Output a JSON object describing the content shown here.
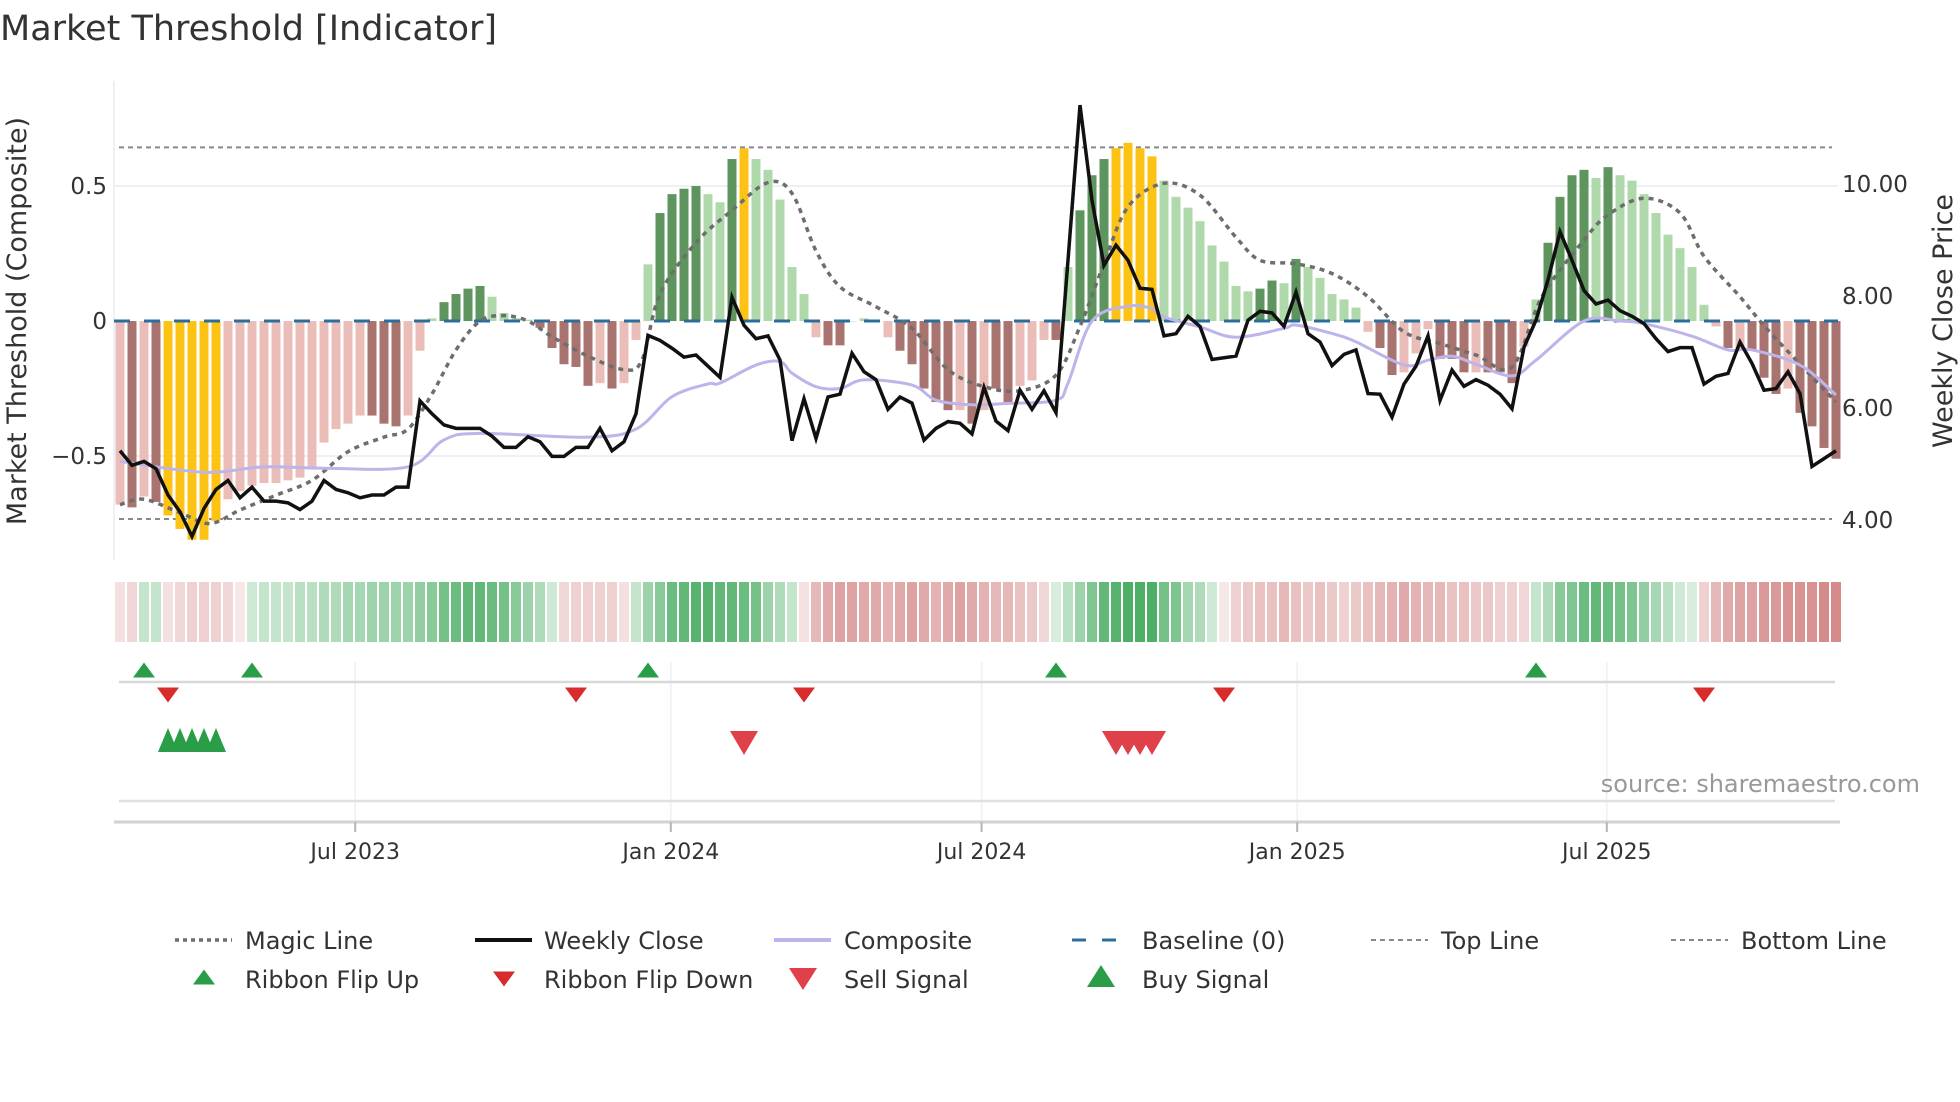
{
  "title": "Market Threshold [Indicator]",
  "source": "source: sharemaestro.com",
  "chart_data": {
    "type": "bar",
    "title": "Market Threshold [Indicator]",
    "left_axis": {
      "label": "Market Threshold (Composite)",
      "range": [
        -0.885,
        0.889
      ],
      "ticks": [
        {
          "value": 0.5,
          "label": "0.5"
        },
        {
          "value": 0,
          "label": "0"
        },
        {
          "value": -0.5,
          "label": "−0.5"
        }
      ]
    },
    "right_axis": {
      "label": "Weekly Close Price",
      "range": [
        3.29,
        11.84
      ],
      "ticks": [
        {
          "value": 10,
          "label": "10.00"
        },
        {
          "value": 8,
          "label": "8.00"
        },
        {
          "value": 6,
          "label": "6.00"
        },
        {
          "value": 4,
          "label": "4.00"
        }
      ]
    },
    "x_axis": {
      "unit": "week index",
      "range": [
        -0.5,
        143.5
      ],
      "ticks": [
        {
          "week": 19.6,
          "label": "Jul 2023"
        },
        {
          "week": 45.9,
          "label": "Jan 2024"
        },
        {
          "week": 71.8,
          "label": "Jul 2024"
        },
        {
          "week": 98.1,
          "label": "Jan 2025"
        },
        {
          "week": 123.9,
          "label": "Jul 2025"
        }
      ]
    },
    "grid": true,
    "legend_placement": "bottom",
    "top_line": 0.643,
    "bottom_line": -0.733,
    "baseline": 0,
    "composite_bars": {
      "values": [
        -0.68,
        -0.69,
        -0.65,
        -0.67,
        -0.72,
        -0.77,
        -0.81,
        -0.81,
        -0.74,
        -0.66,
        -0.63,
        -0.61,
        -0.6,
        -0.6,
        -0.59,
        -0.58,
        -0.55,
        -0.45,
        -0.4,
        -0.38,
        -0.35,
        -0.35,
        -0.38,
        -0.39,
        -0.35,
        -0.11,
        0.01,
        0.07,
        0.1,
        0.12,
        0.13,
        0.09,
        0.03,
        0.01,
        0.005,
        -0.025,
        -0.1,
        -0.16,
        -0.17,
        -0.24,
        -0.23,
        -0.25,
        -0.23,
        -0.07,
        0.21,
        0.4,
        0.47,
        0.49,
        0.5,
        0.47,
        0.44,
        0.6,
        0.64,
        0.6,
        0.56,
        0.45,
        0.2,
        0.1,
        -0.06,
        -0.09,
        -0.09,
        0,
        0.01,
        0,
        -0.06,
        -0.11,
        -0.16,
        -0.25,
        -0.3,
        -0.33,
        -0.33,
        -0.38,
        -0.33,
        -0.25,
        -0.3,
        -0.24,
        -0.22,
        -0.07,
        -0.07,
        0.2,
        0.41,
        0.54,
        0.6,
        0.64,
        0.66,
        0.64,
        0.61,
        0.52,
        0.46,
        0.42,
        0.37,
        0.28,
        0.22,
        0.13,
        0.11,
        0.12,
        0.15,
        0.14,
        0.23,
        0.2,
        0.16,
        0.1,
        0.08,
        0.05,
        -0.04,
        -0.1,
        -0.2,
        -0.19,
        -0.12,
        -0.03,
        -0.14,
        -0.14,
        -0.19,
        -0.19,
        -0.19,
        -0.19,
        -0.23,
        -0.095,
        0.08,
        0.29,
        0.46,
        0.54,
        0.56,
        0.53,
        0.57,
        0.54,
        0.52,
        0.47,
        0.4,
        0.32,
        0.27,
        0.2,
        0.06,
        -0.02,
        -0.1,
        -0.1,
        -0.11,
        -0.21,
        -0.27,
        -0.25,
        -0.34,
        -0.39,
        -0.47,
        -0.51
      ],
      "kind_runs": [
        [
          "lr",
          1
        ],
        [
          "dr",
          1
        ],
        [
          "lr",
          1
        ],
        [
          "dr",
          1
        ],
        [
          "y",
          5
        ],
        [
          "lr",
          12
        ],
        [
          "dr",
          3
        ],
        [
          "lr",
          2
        ],
        [
          "lg",
          1
        ],
        [
          "dg",
          4
        ],
        [
          "lg",
          4
        ],
        [
          "dr",
          5
        ],
        [
          "lr",
          1
        ],
        [
          "dr",
          1
        ],
        [
          "lr",
          2
        ],
        [
          "lg",
          1
        ],
        [
          "dg",
          4
        ],
        [
          "lg",
          2
        ],
        [
          "dg",
          1
        ],
        [
          "y",
          1
        ],
        [
          "lg",
          5
        ],
        [
          "lr",
          1
        ],
        [
          "dr",
          2
        ],
        [
          "lg",
          3
        ],
        [
          "lr",
          1
        ],
        [
          "dr",
          5
        ],
        [
          "lr",
          1
        ],
        [
          "dr",
          1
        ],
        [
          "lr",
          1
        ],
        [
          "dr",
          2
        ],
        [
          "lr",
          3
        ],
        [
          "dr",
          1
        ],
        [
          "lg",
          1
        ],
        [
          "dg",
          3
        ],
        [
          "y",
          4
        ],
        [
          "lg",
          8
        ],
        [
          "dg",
          2
        ],
        [
          "lg",
          1
        ],
        [
          "dg",
          1
        ],
        [
          "lg",
          5
        ],
        [
          "lr",
          1
        ],
        [
          "dr",
          2
        ],
        [
          "lr",
          3
        ],
        [
          "dr",
          3
        ],
        [
          "lr",
          1
        ],
        [
          "dr",
          3
        ],
        [
          "lr",
          1
        ],
        [
          "lg",
          1
        ],
        [
          "dg",
          4
        ],
        [
          "lg",
          1
        ],
        [
          "dg",
          1
        ],
        [
          "lg",
          8
        ],
        [
          "lr",
          1
        ],
        [
          "dr",
          1
        ],
        [
          "lr",
          1
        ],
        [
          "dr",
          3
        ],
        [
          "lr",
          1
        ],
        [
          "dr",
          4
        ]
      ]
    },
    "weekly_close": [
      5.24,
      4.98,
      5.05,
      4.92,
      4.45,
      4.15,
      3.71,
      4.21,
      4.55,
      4.71,
      4.4,
      4.59,
      4.34,
      4.34,
      4.31,
      4.19,
      4.34,
      4.71,
      4.55,
      4.49,
      4.4,
      4.45,
      4.45,
      4.59,
      4.59,
      6.13,
      5.9,
      5.7,
      5.64,
      5.64,
      5.64,
      5.5,
      5.3,
      5.3,
      5.49,
      5.4,
      5.14,
      5.14,
      5.3,
      5.3,
      5.64,
      5.24,
      5.4,
      5.9,
      7.3,
      7.21,
      7.07,
      6.91,
      6.95,
      6.75,
      6.55,
      7.98,
      7.48,
      7.24,
      7.29,
      6.86,
      5.42,
      6.17,
      5.46,
      6.2,
      6.25,
      6.98,
      6.65,
      6.51,
      5.98,
      6.2,
      6.09,
      5.43,
      5.64,
      5.76,
      5.73,
      5.54,
      6.37,
      5.77,
      5.6,
      6.32,
      5.98,
      6.31,
      5.92,
      8.64,
      11.41,
      9.71,
      8.55,
      8.91,
      8.64,
      8.14,
      8.12,
      7.29,
      7.33,
      7.64,
      7.46,
      6.87,
      6.9,
      6.93,
      7.57,
      7.73,
      7.7,
      7.46,
      8.07,
      7.33,
      7.18,
      6.76,
      6.96,
      7.04,
      6.26,
      6.25,
      5.84,
      6.43,
      6.75,
      7.29,
      6.14,
      6.68,
      6.39,
      6.51,
      6.41,
      6.25,
      5.99,
      7.09,
      7.57,
      8.29,
      9.15,
      8.64,
      8.1,
      7.86,
      7.93,
      7.74,
      7.64,
      7.51,
      7.24,
      7.01,
      7.08,
      7.08,
      6.43,
      6.57,
      6.62,
      7.18,
      6.8,
      6.32,
      6.35,
      6.65,
      6.26,
      4.96,
      5.1,
      5.24
    ],
    "composite_line": [
      [
        0,
        -0.52
      ],
      [
        7,
        -0.56
      ],
      [
        12,
        -0.54
      ],
      [
        17,
        -0.545
      ],
      [
        24,
        -0.54
      ],
      [
        27,
        -0.44
      ],
      [
        30,
        -0.416
      ],
      [
        39,
        -0.43
      ],
      [
        43,
        -0.4
      ],
      [
        46,
        -0.28
      ],
      [
        49,
        -0.233
      ],
      [
        50,
        -0.23
      ],
      [
        53,
        -0.163
      ],
      [
        55,
        -0.15
      ],
      [
        56,
        -0.193
      ],
      [
        58,
        -0.243
      ],
      [
        60,
        -0.25
      ],
      [
        62,
        -0.218
      ],
      [
        66,
        -0.237
      ],
      [
        68,
        -0.293
      ],
      [
        71,
        -0.31
      ],
      [
        74,
        -0.305
      ],
      [
        78,
        -0.293
      ],
      [
        79,
        -0.23
      ],
      [
        81,
        0.0
      ],
      [
        84,
        0.055
      ],
      [
        86,
        0.046
      ],
      [
        87,
        0.015
      ],
      [
        90,
        -0.022
      ],
      [
        93,
        -0.06
      ],
      [
        97,
        -0.027
      ],
      [
        98,
        -0.015
      ],
      [
        101,
        -0.046
      ],
      [
        103,
        -0.077
      ],
      [
        107,
        -0.163
      ],
      [
        109,
        -0.145
      ],
      [
        111,
        -0.13
      ],
      [
        113,
        -0.16
      ],
      [
        116,
        -0.203
      ],
      [
        118,
        -0.145
      ],
      [
        122,
        0.0
      ],
      [
        125,
        0.0
      ],
      [
        127,
        -0.01
      ],
      [
        131,
        -0.056
      ],
      [
        134,
        -0.107
      ],
      [
        136,
        -0.107
      ],
      [
        140,
        -0.163
      ],
      [
        143,
        -0.274
      ]
    ],
    "magic_line": [
      [
        0,
        -0.68
      ],
      [
        2,
        -0.66
      ],
      [
        5,
        -0.71
      ],
      [
        7.5,
        -0.75
      ],
      [
        10,
        -0.7
      ],
      [
        13,
        -0.645
      ],
      [
        16,
        -0.59
      ],
      [
        19,
        -0.484
      ],
      [
        22,
        -0.43
      ],
      [
        24,
        -0.4
      ],
      [
        26,
        -0.27
      ],
      [
        28,
        -0.107
      ],
      [
        30,
        0.0
      ],
      [
        32,
        0.02
      ],
      [
        34,
        0.0
      ],
      [
        36,
        -0.058
      ],
      [
        39,
        -0.13
      ],
      [
        42,
        -0.18
      ],
      [
        43.5,
        -0.144
      ],
      [
        45,
        0.1
      ],
      [
        48,
        0.29
      ],
      [
        51,
        0.41
      ],
      [
        54,
        0.513
      ],
      [
        56,
        0.473
      ],
      [
        58,
        0.26
      ],
      [
        60,
        0.127
      ],
      [
        63,
        0.053
      ],
      [
        66,
        -0.027
      ],
      [
        69,
        -0.18
      ],
      [
        72,
        -0.243
      ],
      [
        75,
        -0.258
      ],
      [
        78,
        -0.2
      ],
      [
        80,
        -0.02
      ],
      [
        82,
        0.213
      ],
      [
        84,
        0.423
      ],
      [
        87,
        0.51
      ],
      [
        90,
        0.466
      ],
      [
        93,
        0.31
      ],
      [
        95,
        0.225
      ],
      [
        98,
        0.212
      ],
      [
        101,
        0.176
      ],
      [
        104,
        0.09
      ],
      [
        107,
        -0.04
      ],
      [
        110,
        -0.083
      ],
      [
        113,
        -0.126
      ],
      [
        116,
        -0.17
      ],
      [
        118.5,
        0.09
      ],
      [
        122,
        0.3
      ],
      [
        124,
        0.393
      ],
      [
        127,
        0.455
      ],
      [
        130,
        0.4
      ],
      [
        132,
        0.24
      ],
      [
        135,
        0.09
      ],
      [
        137,
        -0.017
      ],
      [
        140,
        -0.16
      ],
      [
        143,
        -0.3
      ]
    ],
    "ribbon": [
      -0.2,
      -0.25,
      0.3,
      0.3,
      -0.2,
      -0.25,
      -0.3,
      -0.3,
      -0.3,
      -0.25,
      -0.15,
      0.25,
      0.3,
      0.3,
      0.3,
      0.35,
      0.35,
      0.4,
      0.4,
      0.45,
      0.45,
      0.5,
      0.5,
      0.5,
      0.5,
      0.55,
      0.6,
      0.7,
      0.75,
      0.8,
      0.8,
      0.75,
      0.7,
      0.6,
      0.5,
      0.4,
      0.25,
      -0.25,
      -0.3,
      -0.3,
      -0.3,
      -0.3,
      -0.2,
      0.3,
      0.5,
      0.6,
      0.75,
      0.8,
      0.85,
      0.85,
      0.8,
      0.8,
      0.75,
      0.7,
      0.5,
      0.4,
      0.3,
      -0.2,
      -0.45,
      -0.55,
      -0.6,
      -0.6,
      -0.55,
      -0.55,
      -0.5,
      -0.55,
      -0.6,
      -0.55,
      -0.5,
      -0.55,
      -0.6,
      -0.55,
      -0.5,
      -0.45,
      -0.45,
      -0.4,
      -0.35,
      -0.25,
      0.2,
      0.35,
      0.5,
      0.65,
      0.8,
      0.85,
      0.9,
      0.9,
      0.9,
      0.7,
      0.65,
      0.45,
      0.4,
      0.25,
      -0.15,
      -0.3,
      -0.35,
      -0.4,
      -0.4,
      -0.45,
      -0.4,
      -0.35,
      -0.4,
      -0.35,
      -0.3,
      -0.35,
      -0.4,
      -0.45,
      -0.5,
      -0.55,
      -0.5,
      -0.45,
      -0.45,
      -0.4,
      -0.4,
      -0.35,
      -0.35,
      -0.3,
      -0.3,
      -0.25,
      0.3,
      0.4,
      0.6,
      0.65,
      0.75,
      0.8,
      0.75,
      0.7,
      0.65,
      0.55,
      0.45,
      0.35,
      0.25,
      0.2,
      -0.3,
      -0.45,
      -0.55,
      -0.6,
      -0.6,
      -0.65,
      -0.65,
      -0.7,
      -0.7,
      -0.7,
      -0.75,
      -0.75
    ],
    "ribbon_flip_up": [
      2,
      11,
      44,
      78,
      118
    ],
    "ribbon_flip_down": [
      4,
      38,
      57,
      92,
      132
    ],
    "buy_signal": [
      4,
      5,
      6,
      7,
      8
    ],
    "sell_signal": [
      52,
      83,
      84,
      85,
      86
    ],
    "legend": [
      {
        "label": "Magic Line",
        "style": "magic"
      },
      {
        "label": "Weekly Close",
        "style": "close"
      },
      {
        "label": "Composite",
        "style": "composite"
      },
      {
        "label": "Baseline (0)",
        "style": "baseline"
      },
      {
        "label": "Top Line",
        "style": "threshold"
      },
      {
        "label": "Bottom Line",
        "style": "threshold"
      },
      {
        "label": "Ribbon Flip Up",
        "style": "flip_up"
      },
      {
        "label": "Ribbon Flip Down",
        "style": "flip_down"
      },
      {
        "label": "Sell Signal",
        "style": "sell"
      },
      {
        "label": "Buy Signal",
        "style": "buy"
      }
    ],
    "colors": {
      "dr": "#a9736f",
      "lr": "#ebbdb9",
      "dg": "#5e945e",
      "lg": "#afd9ab",
      "y": "#fcc314",
      "close": "#111111",
      "composite": "#bdb4ea",
      "magic": "#6e6e6e",
      "baseline": "#2b6e9b",
      "threshold": "#888888",
      "flip_up": "#2a9d49",
      "flip_down": "#d62c2c",
      "buy": "#2a9d49",
      "sell": "#e0404a",
      "ribbon_green": "#3aa655",
      "ribbon_red": "#c86464"
    }
  }
}
